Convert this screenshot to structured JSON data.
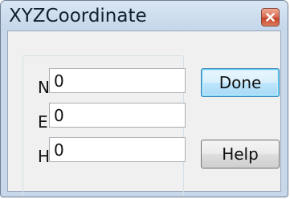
{
  "window": {
    "title": "XYZCoordinate",
    "close_icon": "close-icon",
    "accent_color": "#c8d8ea",
    "close_color": "#d86a52"
  },
  "fields": [
    {
      "label": "N:",
      "value": "0"
    },
    {
      "label": "E:",
      "value": "0"
    },
    {
      "label": "H:",
      "value": "0"
    }
  ],
  "buttons": {
    "done_label": "Done",
    "help_label": "Help"
  }
}
